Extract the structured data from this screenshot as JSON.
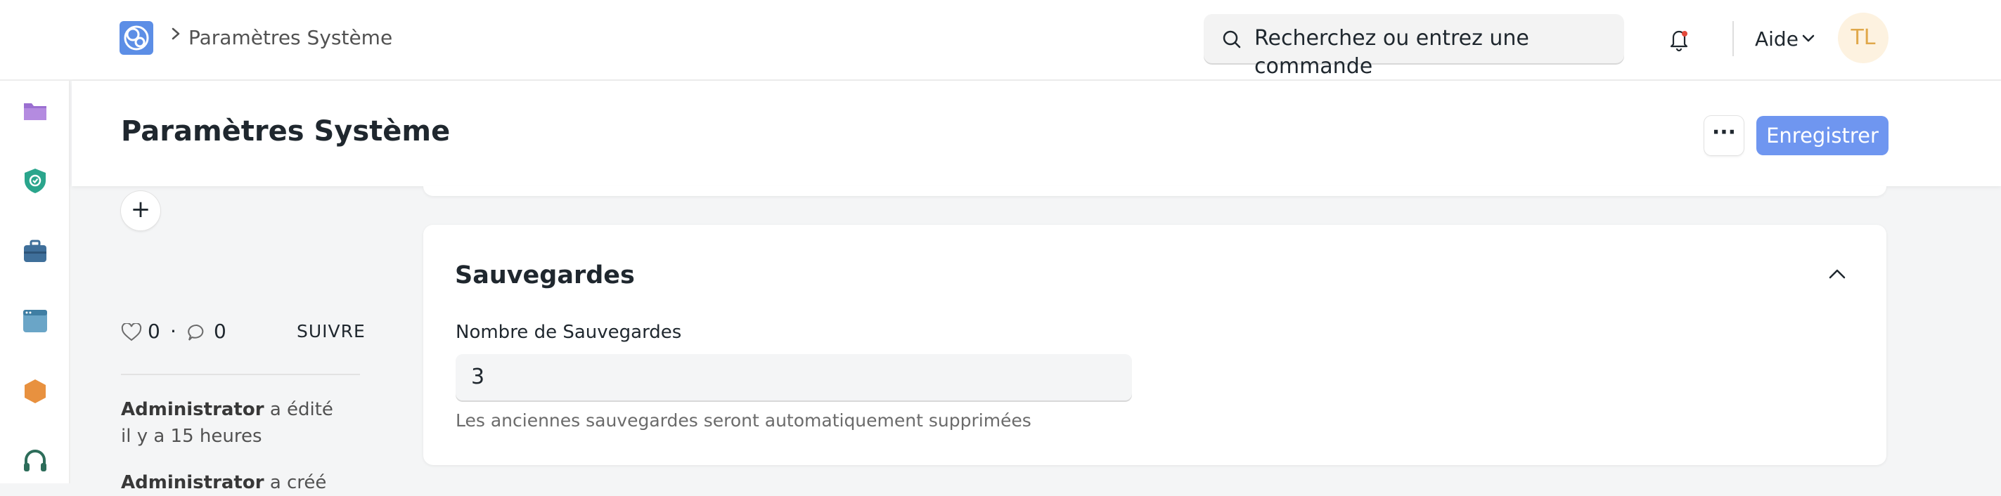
{
  "navbar": {
    "breadcrumb": "Paramètres Système",
    "search_placeholder": "Recherchez ou entrez une commande",
    "help_label": "Aide",
    "avatar_initials": "TL"
  },
  "sidebar": {
    "icons": [
      "folder-icon",
      "shield-check-icon",
      "briefcase-icon",
      "browser-window-icon",
      "hexagon-icon",
      "headset-icon"
    ]
  },
  "page": {
    "title": "Paramètres Système",
    "more_label": "···",
    "save_label": "Enregistrer"
  },
  "left_panel": {
    "likes": "0",
    "separator": "·",
    "comments": "0",
    "follow_label": "SUIVRE",
    "activity": [
      {
        "user": "Administrator",
        "action": "a édité",
        "time": "il y a 15 heures"
      },
      {
        "user": "Administrator",
        "action": "a créé",
        "time": ""
      }
    ]
  },
  "section": {
    "title": "Sauvegardes",
    "field_label": "Nombre de Sauvegardes",
    "field_value": "3",
    "field_description": "Les anciennes sauvegardes seront automatiquement supprimées"
  },
  "colors": {
    "primary": "#6f96f0",
    "avatar_bg": "#fdf2e0",
    "avatar_text": "#e0a84a",
    "notification_dot": "#e2493b"
  }
}
